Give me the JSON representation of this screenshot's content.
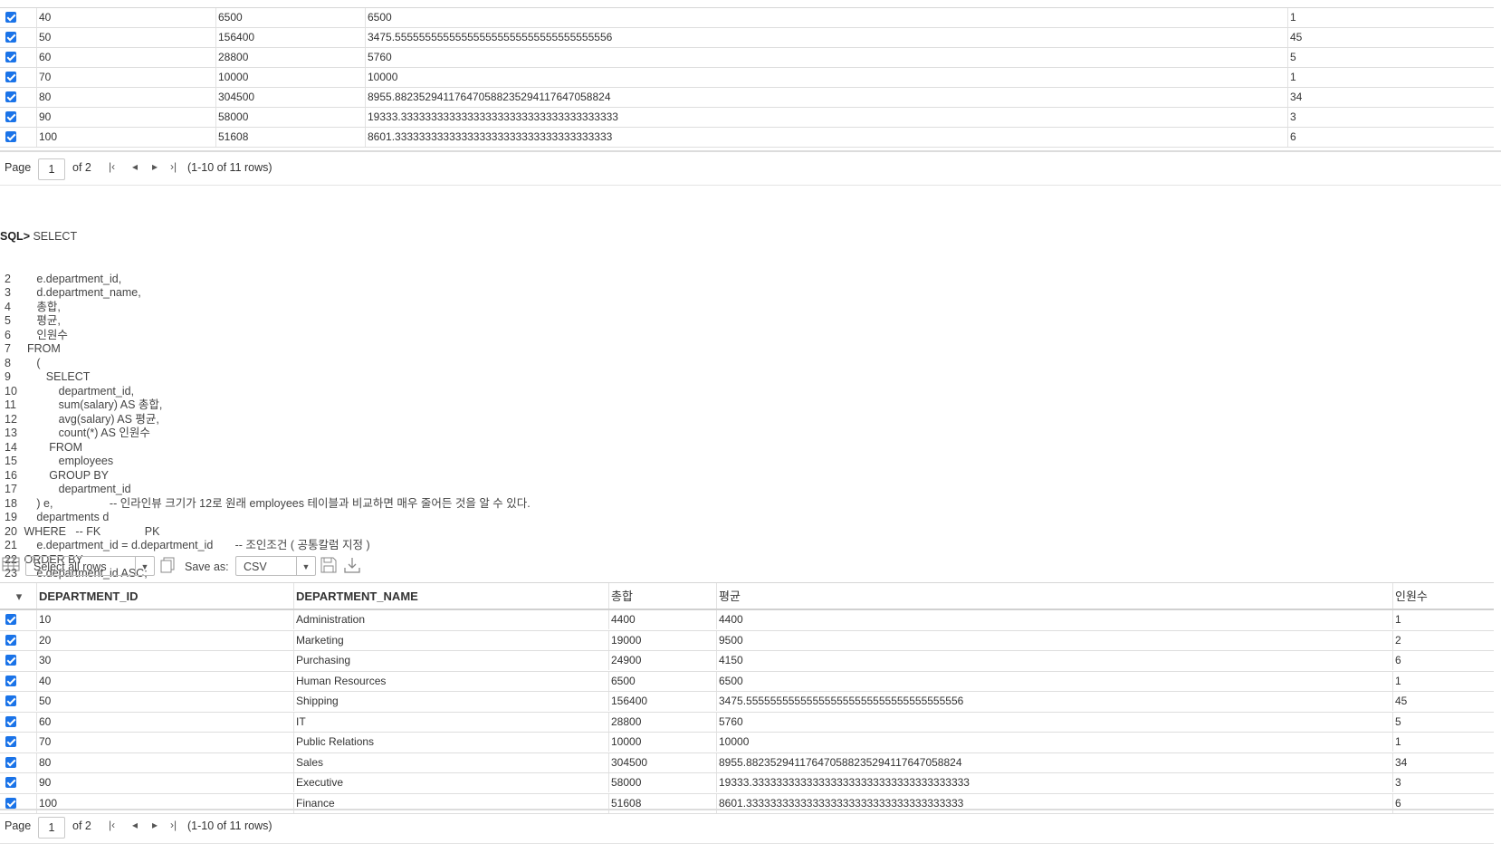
{
  "top_grid": {
    "rows": [
      {
        "id": "40",
        "sum": "6500",
        "avg": "6500",
        "count": "1"
      },
      {
        "id": "50",
        "sum": "156400",
        "avg": "3475.555555555555555555555555555555555556",
        "count": "45"
      },
      {
        "id": "60",
        "sum": "28800",
        "avg": "5760",
        "count": "5"
      },
      {
        "id": "70",
        "sum": "10000",
        "avg": "10000",
        "count": "1"
      },
      {
        "id": "80",
        "sum": "304500",
        "avg": "8955.882352941176470588235294117647058824",
        "count": "34"
      },
      {
        "id": "90",
        "sum": "58000",
        "avg": "19333.333333333333333333333333333333333333",
        "count": "3"
      },
      {
        "id": "100",
        "sum": "51608",
        "avg": "8601.333333333333333333333333333333333333",
        "count": "6"
      }
    ],
    "pager": {
      "page_label": "Page",
      "page_value": "1",
      "of_label": "of 2",
      "rows_label": "(1-10 of 11 rows)"
    }
  },
  "sql": {
    "prompt": "SQL>",
    "first_line": " SELECT",
    "lines": [
      {
        "n": "2",
        "text": "     e.department_id,"
      },
      {
        "n": "3",
        "text": "     d.department_name,"
      },
      {
        "n": "4",
        "text": "     총합,"
      },
      {
        "n": "5",
        "text": "     평균,"
      },
      {
        "n": "6",
        "text": "     인원수"
      },
      {
        "n": "7",
        "text": "  FROM"
      },
      {
        "n": "8",
        "text": "     ("
      },
      {
        "n": "9",
        "text": "        SELECT"
      },
      {
        "n": "10",
        "text": "            department_id,"
      },
      {
        "n": "11",
        "text": "            sum(salary) AS 총합,"
      },
      {
        "n": "12",
        "text": "            avg(salary) AS 평균,"
      },
      {
        "n": "13",
        "text": "            count(*) AS 인원수"
      },
      {
        "n": "14",
        "text": "         FROM"
      },
      {
        "n": "15",
        "text": "            employees"
      },
      {
        "n": "16",
        "text": "         GROUP BY"
      },
      {
        "n": "17",
        "text": "            department_id"
      },
      {
        "n": "18",
        "text": "     ) e,                  -- 인라인뷰 크기가 12로 원래 employees 테이블과 비교하면 매우 줄어든 것을 알 수 있다."
      },
      {
        "n": "19",
        "text": "     departments d"
      },
      {
        "n": "20",
        "text": " WHERE   -- FK              PK"
      },
      {
        "n": "21",
        "text": "     e.department_id = d.department_id       -- 조인조건 ( 공통칼럼 지정 )"
      },
      {
        "n": "22",
        "text": " ORDER BY"
      },
      {
        "n": "23",
        "text": "     e.department_id ASC;"
      }
    ]
  },
  "toolbar": {
    "select_rows": "Select all rows",
    "save_as": "Save as:",
    "format": "CSV"
  },
  "result_grid": {
    "headers": {
      "id": "DEPARTMENT_ID",
      "name": "DEPARTMENT_NAME",
      "sum": "총합",
      "avg": "평균",
      "count": "인원수"
    },
    "rows": [
      {
        "id": "10",
        "name": "Administration",
        "sum": "4400",
        "avg": "4400",
        "count": "1"
      },
      {
        "id": "20",
        "name": "Marketing",
        "sum": "19000",
        "avg": "9500",
        "count": "2"
      },
      {
        "id": "30",
        "name": "Purchasing",
        "sum": "24900",
        "avg": "4150",
        "count": "6"
      },
      {
        "id": "40",
        "name": "Human Resources",
        "sum": "6500",
        "avg": "6500",
        "count": "1"
      },
      {
        "id": "50",
        "name": "Shipping",
        "sum": "156400",
        "avg": "3475.555555555555555555555555555555555556",
        "count": "45"
      },
      {
        "id": "60",
        "name": "IT",
        "sum": "28800",
        "avg": "5760",
        "count": "5"
      },
      {
        "id": "70",
        "name": "Public Relations",
        "sum": "10000",
        "avg": "10000",
        "count": "1"
      },
      {
        "id": "80",
        "name": "Sales",
        "sum": "304500",
        "avg": "8955.882352941176470588235294117647058824",
        "count": "34"
      },
      {
        "id": "90",
        "name": "Executive",
        "sum": "58000",
        "avg": "19333.333333333333333333333333333333333333",
        "count": "3"
      },
      {
        "id": "100",
        "name": "Finance",
        "sum": "51608",
        "avg": "8601.333333333333333333333333333333333333",
        "count": "6"
      }
    ],
    "pager": {
      "page_label": "Page",
      "page_value": "1",
      "of_label": "of 2",
      "rows_label": "(1-10 of 11 rows)"
    }
  }
}
